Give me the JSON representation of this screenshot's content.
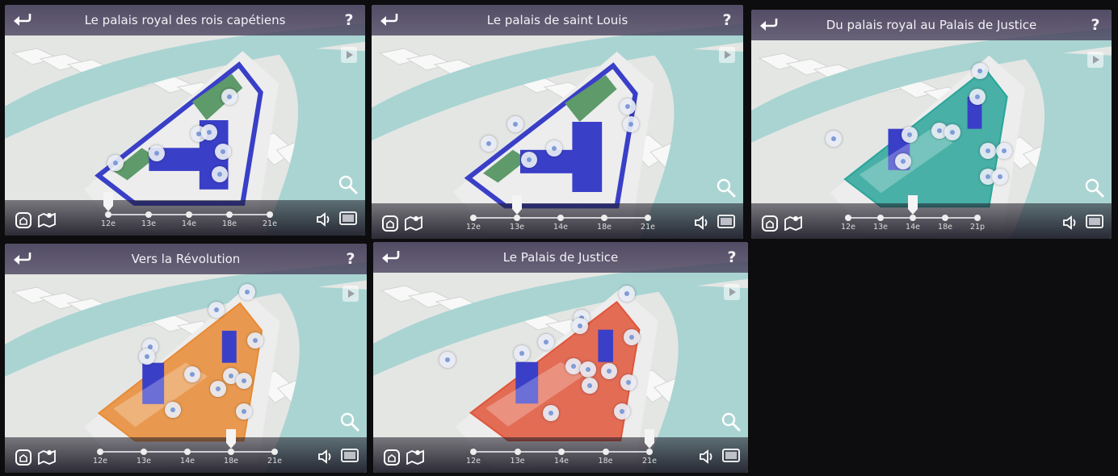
{
  "panels": [
    {
      "id": "p1",
      "title": "Le palais royal des rois capétiens",
      "active": "12e",
      "theme": "blue"
    },
    {
      "id": "p2",
      "title": "Le palais de saint Louis",
      "active": "13e",
      "theme": "blue"
    },
    {
      "id": "p3",
      "title": "Du palais royal au Palais de Justice",
      "active": "14e",
      "theme": "teal"
    },
    {
      "id": "p4",
      "title": "Vers la Révolution",
      "active": "18e",
      "theme": "orange"
    },
    {
      "id": "p5",
      "title": "Le Palais de Justice",
      "active": "21e",
      "theme": "red"
    }
  ],
  "timeline": {
    "p1": [
      "12e",
      "13e",
      "14e",
      "18e",
      "21e"
    ],
    "p2": [
      "12e",
      "13e",
      "14e",
      "18e",
      "21e"
    ],
    "p3": [
      "12e",
      "13e",
      "14e",
      "18e",
      "21p"
    ],
    "p4": [
      "12e",
      "13e",
      "14e",
      "18e",
      "21e"
    ],
    "p5": [
      "12e",
      "13e",
      "14e",
      "18e",
      "21e"
    ]
  },
  "colors": {
    "water": "#a9d4d2",
    "land": "#e4e6e4",
    "streets": "#f7f8f7",
    "blue": "#3a3fc8",
    "teal": "#2aa59a",
    "orange": "#e88a33",
    "red": "#e0553a",
    "garden": "#5e9a6a",
    "topbar": "#463e5a"
  },
  "icons": {
    "back": "back-arrow-icon",
    "help": "help-icon",
    "home": "home-icon",
    "map": "map-icon",
    "sound": "sound-icon",
    "screen": "screen-icon",
    "zoom": "zoom-icon",
    "play": "play-icon",
    "poi": "point-of-interest-icon"
  }
}
